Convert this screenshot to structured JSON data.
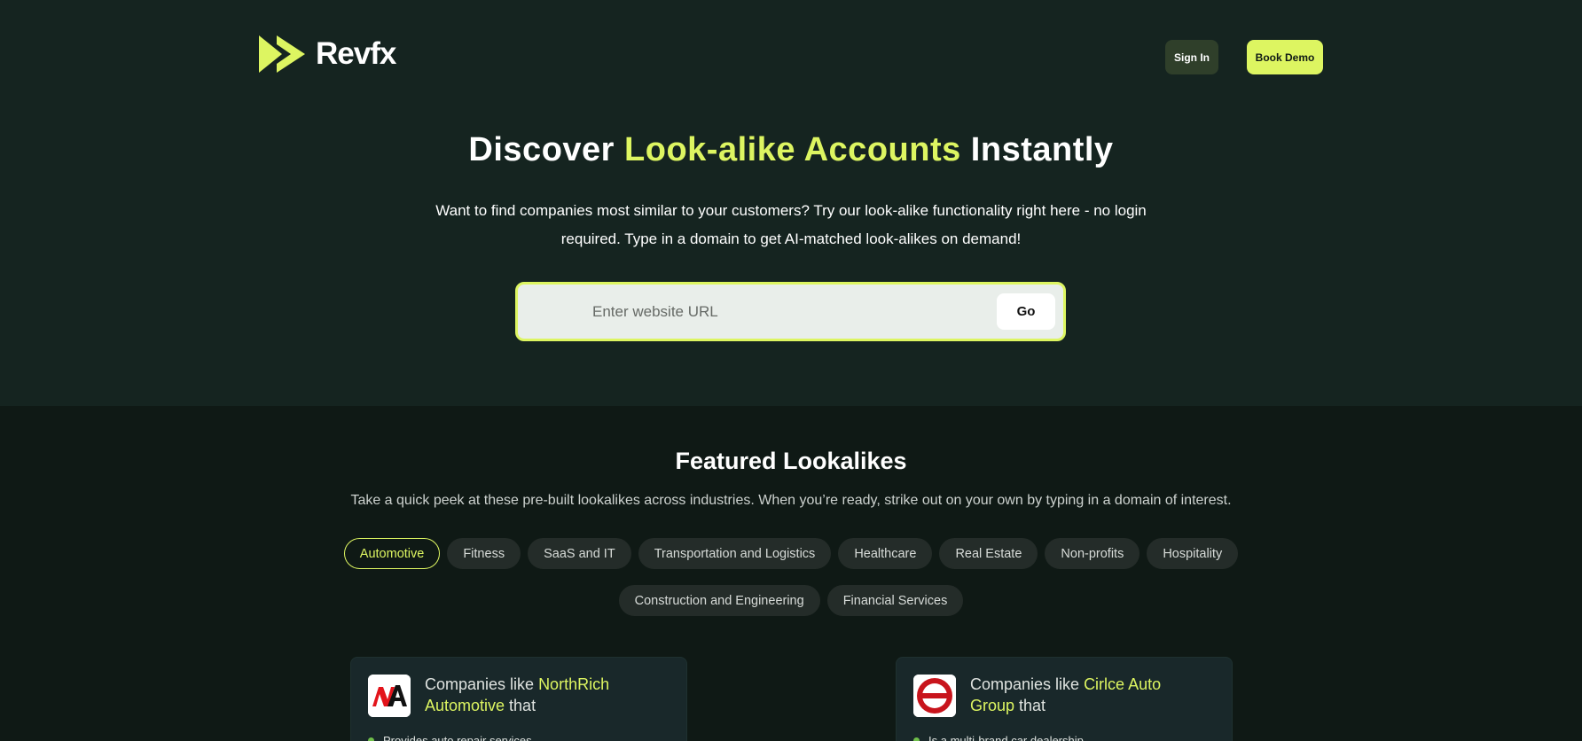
{
  "brand": {
    "name": "Revfx",
    "accent": "#ddf561"
  },
  "header": {
    "signin_label": "Sign In",
    "book_demo_label": "Book Demo"
  },
  "hero": {
    "title_pre": "Discover ",
    "title_highlight": "Look-alike Accounts",
    "title_post": " Instantly",
    "subtitle": "Want to find companies most similar to your customers? Try our look-alike functionality right here - no login required. Type in a domain to get AI-matched look-alikes on demand!",
    "search_placeholder": "Enter website URL",
    "go_label": "Go"
  },
  "featured": {
    "title": "Featured Lookalikes",
    "subtitle": "Take a quick peek at these pre-built lookalikes across industries. When you’re ready, strike out on your own by typing in a domain of interest.",
    "categories_row1": [
      "Automotive",
      "Fitness",
      "SaaS and IT",
      "Transportation and Logistics",
      "Healthcare",
      "Real Estate",
      "Non-profits",
      "Hospitality"
    ],
    "categories_row2": [
      "Construction and Engineering",
      "Financial Services"
    ],
    "active_category": "Automotive"
  },
  "cards": [
    {
      "prefix": "Companies like ",
      "company": "NorthRich Automotive",
      "suffix": " that",
      "bullet": "Provides auto repair services",
      "logo": "northrich-logo"
    },
    {
      "prefix": "Companies like ",
      "company": "Cirlce Auto Group",
      "suffix": " that",
      "bullet": "Is a multi-brand car dealership",
      "logo": "circle-auto-logo"
    }
  ]
}
